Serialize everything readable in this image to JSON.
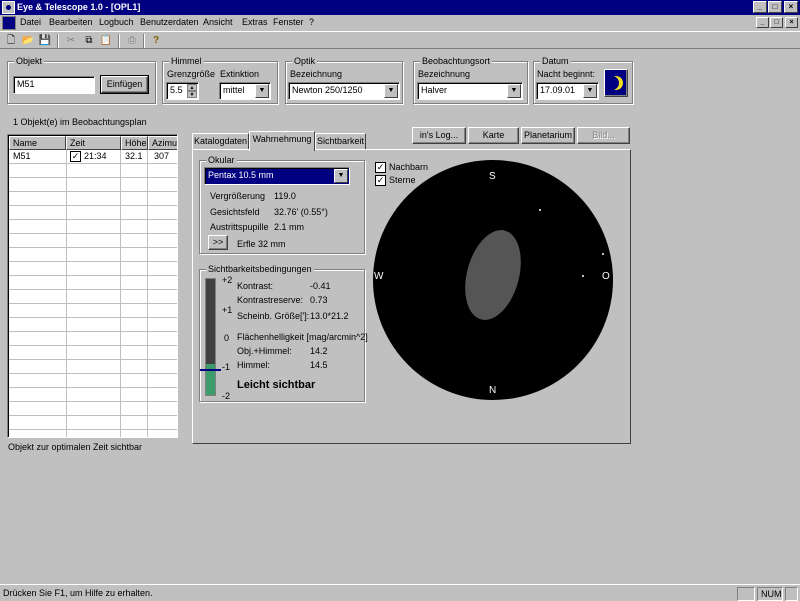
{
  "window": {
    "title": "Eye & Telescope 1.0 - [OPL1]"
  },
  "caption_buttons": {
    "minimize": "_",
    "maximize": "□",
    "close": "×"
  },
  "menu": {
    "items": [
      "Datei",
      "Bearbeiten",
      "Logbuch",
      "Benutzerdaten",
      "Ansicht",
      "Extras",
      "Fenster",
      "?"
    ]
  },
  "toolbar": {
    "icons": [
      "new-file-icon",
      "open-folder-icon",
      "save-disk-icon",
      "cut-icon",
      "copy-icon",
      "paste-icon",
      "print-icon",
      "help-icon"
    ]
  },
  "objekt": {
    "legend": "Objekt",
    "value": "M51",
    "button": "Einfügen"
  },
  "himmel": {
    "legend": "Himmel",
    "grenz_label": "Grenzgröße",
    "grenz_value": "5.5",
    "ext_label": "Extinktion",
    "ext_value": "mittel"
  },
  "optik": {
    "legend": "Optik",
    "label": "Bezeichnung",
    "value": "Newton 250/1250"
  },
  "ort": {
    "legend": "Beobachtungsort",
    "label": "Bezeichnung",
    "value": "Halver"
  },
  "datum": {
    "legend": "Datum",
    "label": "Nacht beginnt:",
    "value": "17.09.01"
  },
  "plan": {
    "count_text": "1 Objekt(e) im Beobachtungsplan",
    "columns": [
      "Name",
      "Zeit",
      "Höhe",
      "Azimut"
    ],
    "rows": [
      {
        "name": "M51",
        "checked": true,
        "zeit": "21:34",
        "hoehe": "32.1",
        "azimut": "307"
      }
    ],
    "footer": "Objekt zur optimalen Zeit sichtbar"
  },
  "tabs": [
    "Katalogdaten",
    "Wahrnehmung",
    "Sichtbarkeit"
  ],
  "active_tab": 1,
  "action_buttons": {
    "log": "in's Log...",
    "karte": "Karte",
    "planetarium": "Planetarium",
    "bild": "Bild..."
  },
  "okular": {
    "legend": "Okular",
    "value": "Pentax 10.5 mm",
    "rows": [
      {
        "label": "Vergrößerung",
        "value": "119.0"
      },
      {
        "label": "Gesichtsfeld",
        "value": "32.76' (0.55°)"
      },
      {
        "label": "Austrittspupille",
        "value": "2.1 mm"
      }
    ],
    "more_button": ">>",
    "erfle": "Erfle 32 mm"
  },
  "sichtbarkeit": {
    "legend": "Sichtbarkeitsbedingungen",
    "scale": [
      "+2",
      "+1",
      "0",
      "-1",
      "-2"
    ],
    "level": 0.27,
    "marker": 0.21,
    "rows": [
      {
        "label": "Kontrast:",
        "value": "-0.41"
      },
      {
        "label": "Kontrastreserve:",
        "value": "0.73"
      },
      {
        "label": "Scheinb. Größe[']:",
        "value": "13.0*21.2"
      }
    ],
    "flaeche_label": "Flächenhelligkeit [mag/arcmin^2]",
    "rows2": [
      {
        "label": "Obj.+Himmel:",
        "value": "14.2"
      },
      {
        "label": "Himmel:",
        "value": "14.5"
      }
    ],
    "result": "Leicht sichtbar"
  },
  "view": {
    "nachbarn_label": "Nachbarn",
    "nachbarn_checked": true,
    "sterne_label": "Sterne",
    "sterne_checked": true,
    "compass": {
      "north_top": "S",
      "south_bottom": "N",
      "west": "W",
      "east": "O"
    }
  },
  "status": {
    "help": "Drücken Sie F1, um Hilfe zu erhalten.",
    "num": "NUM"
  },
  "colors": {
    "titlebar": "#000080",
    "gauge_fill": "#3c9c6c",
    "marker": "#000080",
    "fov": "#000000",
    "object": "#555555"
  }
}
